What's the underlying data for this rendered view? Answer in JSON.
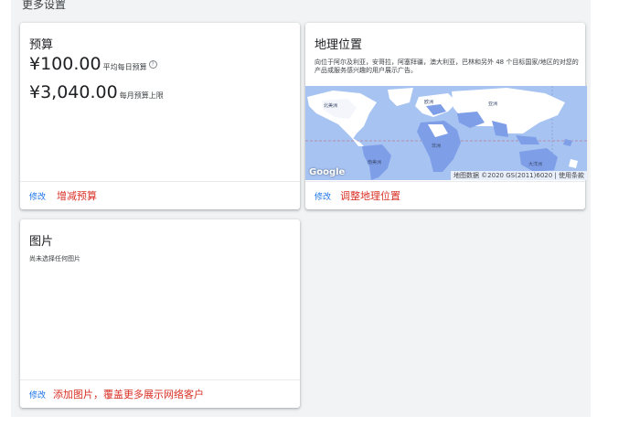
{
  "page": {
    "section_title": "更多设置"
  },
  "budget_card": {
    "title": "预算",
    "daily_amount": "¥100.00",
    "daily_label": "平均每日预算",
    "monthly_amount": "¥3,040.00",
    "monthly_label": "每月预算上限",
    "edit_label": "修改",
    "action_label": "增减预算"
  },
  "location_card": {
    "title": "地理位置",
    "description": "向位于阿尔及利亚，安哥拉，阿塞拜疆，澳大利亚，巴林和另外 48 个目标国家/地区的对您的产品或服务感兴趣的用户展示广告。",
    "map_google": "Google",
    "map_attribution": "地图数据 ©2020 GS(2011)6020 | 使用条款",
    "labels": {
      "north_america": "北美洲",
      "south_america": "南美洲",
      "europe": "欧洲",
      "asia": "亚洲",
      "africa": "非洲",
      "oceania": "大洋洲"
    },
    "edit_label": "修改",
    "action_label": "调整地理位置",
    "colors": {
      "ocean": "#a6c3f2",
      "land": "#ffffff",
      "selected": "#7f9ee8"
    }
  },
  "image_card": {
    "title": "图片",
    "status_text": "尚未选择任何图片",
    "edit_label": "修改",
    "action_label": "添加图片，覆盖更多展示网络客户"
  }
}
